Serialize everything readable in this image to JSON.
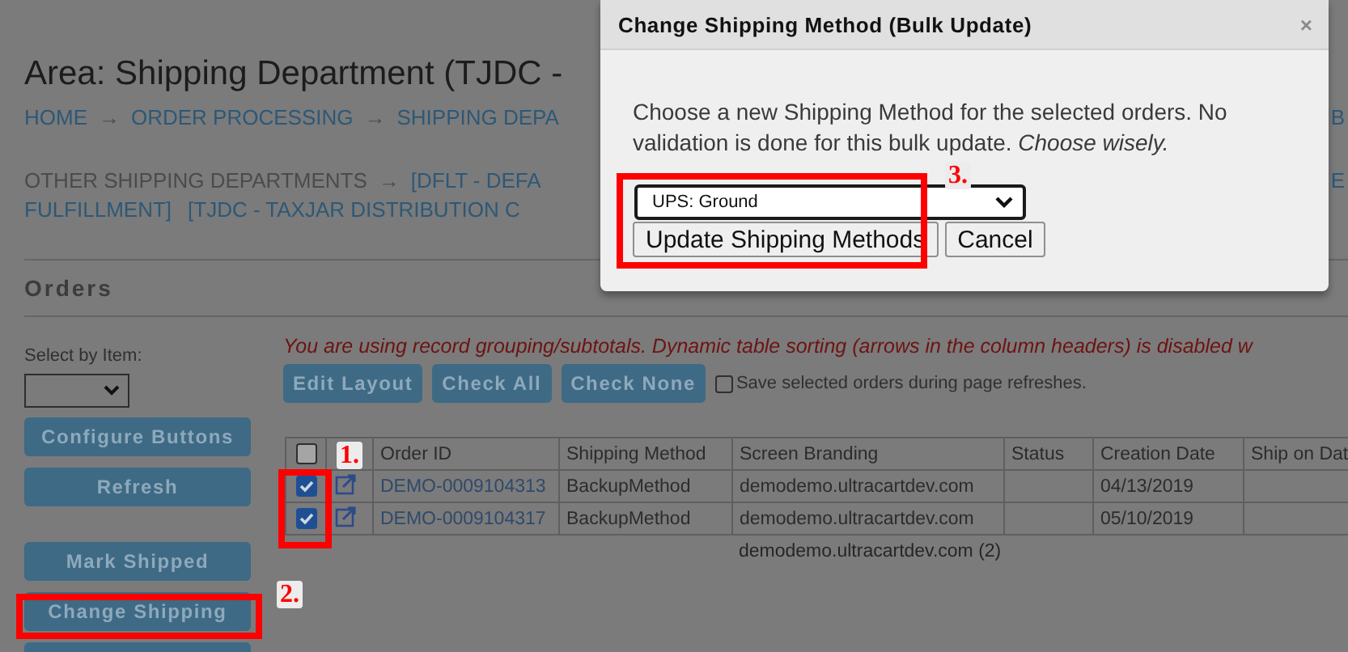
{
  "header": {
    "title": "Area: Shipping Department (TJDC -",
    "breadcrumb": [
      {
        "label": "HOME",
        "arrow": "→"
      },
      {
        "label": "ORDER PROCESSING",
        "arrow": "→"
      },
      {
        "label": "SHIPPING DEPA"
      }
    ],
    "breadcrumb_tail": "B",
    "other_departments": {
      "label": "OTHER SHIPPING DEPARTMENTS",
      "arrow": "→",
      "line_1": [
        "[DFLT - DEFA"
      ],
      "line_1_tail": "E",
      "line_2": [
        "FULFILLMENT]",
        "[TJDC - TAXJAR DISTRIBUTION C"
      ]
    }
  },
  "section_title": "Orders",
  "sidebar": {
    "select_label": "Select by Item:",
    "button_groups": [
      [
        "Configure Buttons",
        "Refresh"
      ],
      [
        "Mark Shipped",
        "Change Shipping"
      ]
    ]
  },
  "notice": "You are using record grouping/subtotals. Dynamic table sorting (arrows in the column headers) is disabled w",
  "toolbar": {
    "buttons": [
      "Edit Layout",
      "Check All",
      "Check None"
    ],
    "save_option": {
      "label": "Save selected orders during page refreshes.",
      "checked": false
    }
  },
  "table": {
    "columns": [
      {
        "kind": "checkbox",
        "checked": false
      },
      {
        "kind": "blank"
      },
      {
        "kind": "text",
        "label": "Order ID"
      },
      {
        "kind": "text",
        "label": "Shipping Method"
      },
      {
        "kind": "text",
        "label": "Screen Branding"
      },
      {
        "kind": "text",
        "label": "Status"
      },
      {
        "kind": "text",
        "label": "Creation Date"
      },
      {
        "kind": "text",
        "label": "Ship on Dat"
      }
    ],
    "rows": [
      {
        "checked": true,
        "order_id": "DEMO-0009104313",
        "shipping_method": "BackupMethod",
        "screen_branding": "demodemo.ultracartdev.com",
        "creation_date": "04/13/2019"
      },
      {
        "checked": true,
        "order_id": "DEMO-0009104317",
        "shipping_method": "BackupMethod",
        "screen_branding": "demodemo.ultracartdev.com",
        "creation_date": "05/10/2019"
      }
    ],
    "subtotal": "demodemo.ultracartdev.com (2)"
  },
  "modal": {
    "title": "Change Shipping Method (Bulk Update)",
    "close": "×",
    "message": "Choose a new Shipping Method for the selected orders. No validation is done for this bulk update. *Choose wisely.*",
    "select_value": "UPS: Ground",
    "buttons": [
      "Update Shipping Methods",
      "Cancel"
    ]
  },
  "annotations": [
    {
      "label": "1."
    },
    {
      "label": "2."
    },
    {
      "label": "3."
    }
  ]
}
